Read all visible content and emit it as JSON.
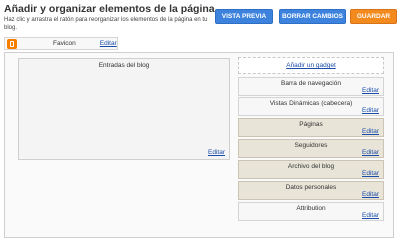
{
  "header": {
    "title": "Añadir y organizar elementos de la página",
    "subtitle": "Haz clic y arrastra el ratón para reorganizar los elementos de la página en tu blog."
  },
  "toolbar": {
    "preview_label": "VISTA PREVIA",
    "clear_label": "BORRAR CAMBIOS",
    "save_label": "GUARDAR"
  },
  "favicon": {
    "label": "Favicon",
    "edit": "Editar"
  },
  "main_column": {
    "label": "Entradas del blog",
    "edit": "Editar"
  },
  "sidebar": {
    "add_gadget": "Añadir un gadget",
    "gadgets": [
      {
        "label": "Barra de navegación",
        "edit": "Editar"
      },
      {
        "label": "Vistas Dinámicas (cabecera)",
        "edit": "Editar"
      },
      {
        "label": "Páginas",
        "edit": "Editar"
      },
      {
        "label": "Seguidores",
        "edit": "Editar"
      },
      {
        "label": "Archivo del blog",
        "edit": "Editar"
      },
      {
        "label": "Datos personales",
        "edit": "Editar"
      },
      {
        "label": "Attribution",
        "edit": "Editar"
      }
    ]
  },
  "colors": {
    "blue_button": "#3d83dd",
    "orange_button": "#f28a1e",
    "link": "#1a4da8",
    "gadget_dark": "#e9e4d8"
  }
}
